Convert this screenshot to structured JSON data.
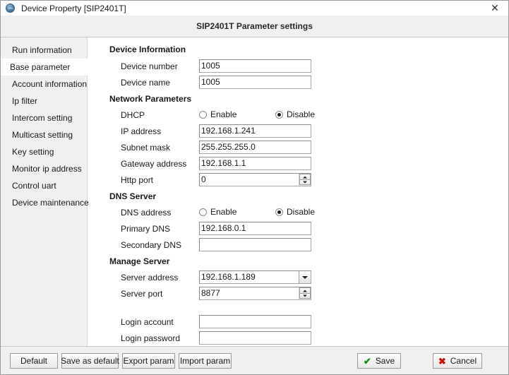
{
  "window": {
    "title": "Device Property [SIP2401T]",
    "icon": "globe-icon",
    "close_label": "✕"
  },
  "header": {
    "title": "SIP2401T Parameter settings"
  },
  "sidebar": {
    "items": [
      {
        "label": "Run information",
        "selected": false
      },
      {
        "label": "Base parameter",
        "selected": true
      },
      {
        "label": "Account information",
        "selected": false
      },
      {
        "label": "Ip filter",
        "selected": false
      },
      {
        "label": "Intercom setting",
        "selected": false
      },
      {
        "label": "Multicast setting",
        "selected": false
      },
      {
        "label": "Key setting",
        "selected": false
      },
      {
        "label": "Monitor ip address",
        "selected": false
      },
      {
        "label": "Control uart",
        "selected": false
      },
      {
        "label": "Device maintenance",
        "selected": false
      }
    ]
  },
  "form": {
    "groups": {
      "device_information": "Device Information",
      "network_parameters": "Network Parameters",
      "dns_server": "DNS Server",
      "manage_server": "Manage Server"
    },
    "labels": {
      "device_number": "Device number",
      "device_name": "Device name",
      "dhcp": "DHCP",
      "ip_address": "IP address",
      "subnet_mask": "Subnet mask",
      "gateway_address": "Gateway address",
      "http_port": "Http port",
      "dns_address": "DNS address",
      "primary_dns": "Primary DNS",
      "secondary_dns": "Secondary DNS",
      "server_address": "Server address",
      "server_port": "Server port",
      "login_account": "Login account",
      "login_password": "Login password"
    },
    "values": {
      "device_number": "1005",
      "device_name": "1005",
      "ip_address": "192.168.1.241",
      "subnet_mask": "255.255.255.0",
      "gateway_address": "192.168.1.1",
      "http_port": "0",
      "primary_dns": "192.168.0.1",
      "secondary_dns": "",
      "server_address": "192.168.1.189",
      "server_port": "8877",
      "login_account": "",
      "login_password": ""
    },
    "radio_options": {
      "enable": "Enable",
      "disable": "Disable"
    },
    "radio_state": {
      "dhcp": "Disable",
      "dns_address": "Disable"
    },
    "server_address_options": [
      "192.168.1.189"
    ]
  },
  "footer": {
    "default_label": "Default",
    "save_as_default_label": "Save as default",
    "export_param_label": "Export param",
    "import_param_label": "Import param",
    "save_label": "Save",
    "cancel_label": "Cancel",
    "save_glyph": "✔",
    "cancel_glyph": "✖"
  },
  "colors": {
    "save_accent": "#119011",
    "cancel_accent": "#cc1111",
    "chrome": "#f0f0f0"
  }
}
